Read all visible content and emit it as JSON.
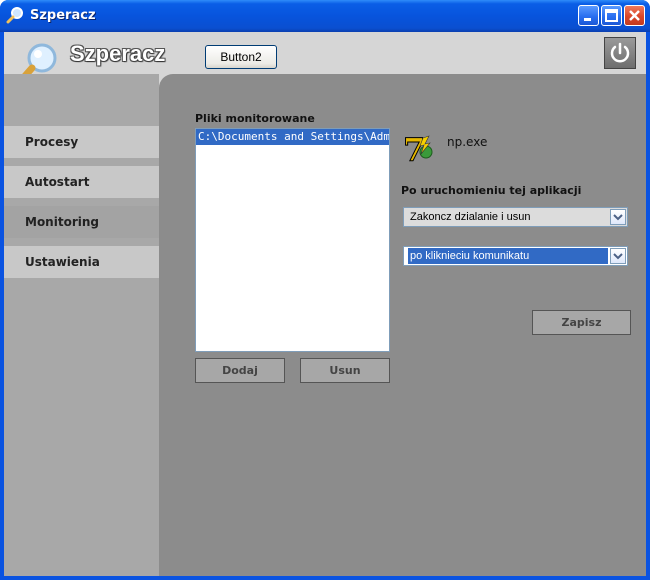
{
  "window": {
    "title": "Szperacz"
  },
  "header": {
    "app_title": "Szperacz",
    "button2_label": "Button2"
  },
  "sidebar": {
    "items": [
      {
        "label": "Procesy"
      },
      {
        "label": "Autostart"
      },
      {
        "label": "Monitoring",
        "active": true
      },
      {
        "label": "Ustawienia"
      }
    ]
  },
  "monitoring": {
    "files_label": "Pliki monitorowane",
    "files": [
      "C:\\Documents and Settings\\Adminis"
    ],
    "add_button": "Dodaj",
    "remove_button": "Usun",
    "exe_name": "np.exe",
    "after_launch_label": "Po uruchomieniu tej aplikacji",
    "action_select": "Zakoncz dzialanie i usun",
    "trigger_select": "po kliknieciu komunikatu",
    "save_button": "Zapisz"
  },
  "icons": {
    "title": "magnifier-icon",
    "logo": "magnifier-icon",
    "power": "power-icon",
    "exe": "application-icon"
  },
  "colors": {
    "titlebar": "#0754dd",
    "selection": "#316ac5",
    "close_button": "#d9462a"
  }
}
